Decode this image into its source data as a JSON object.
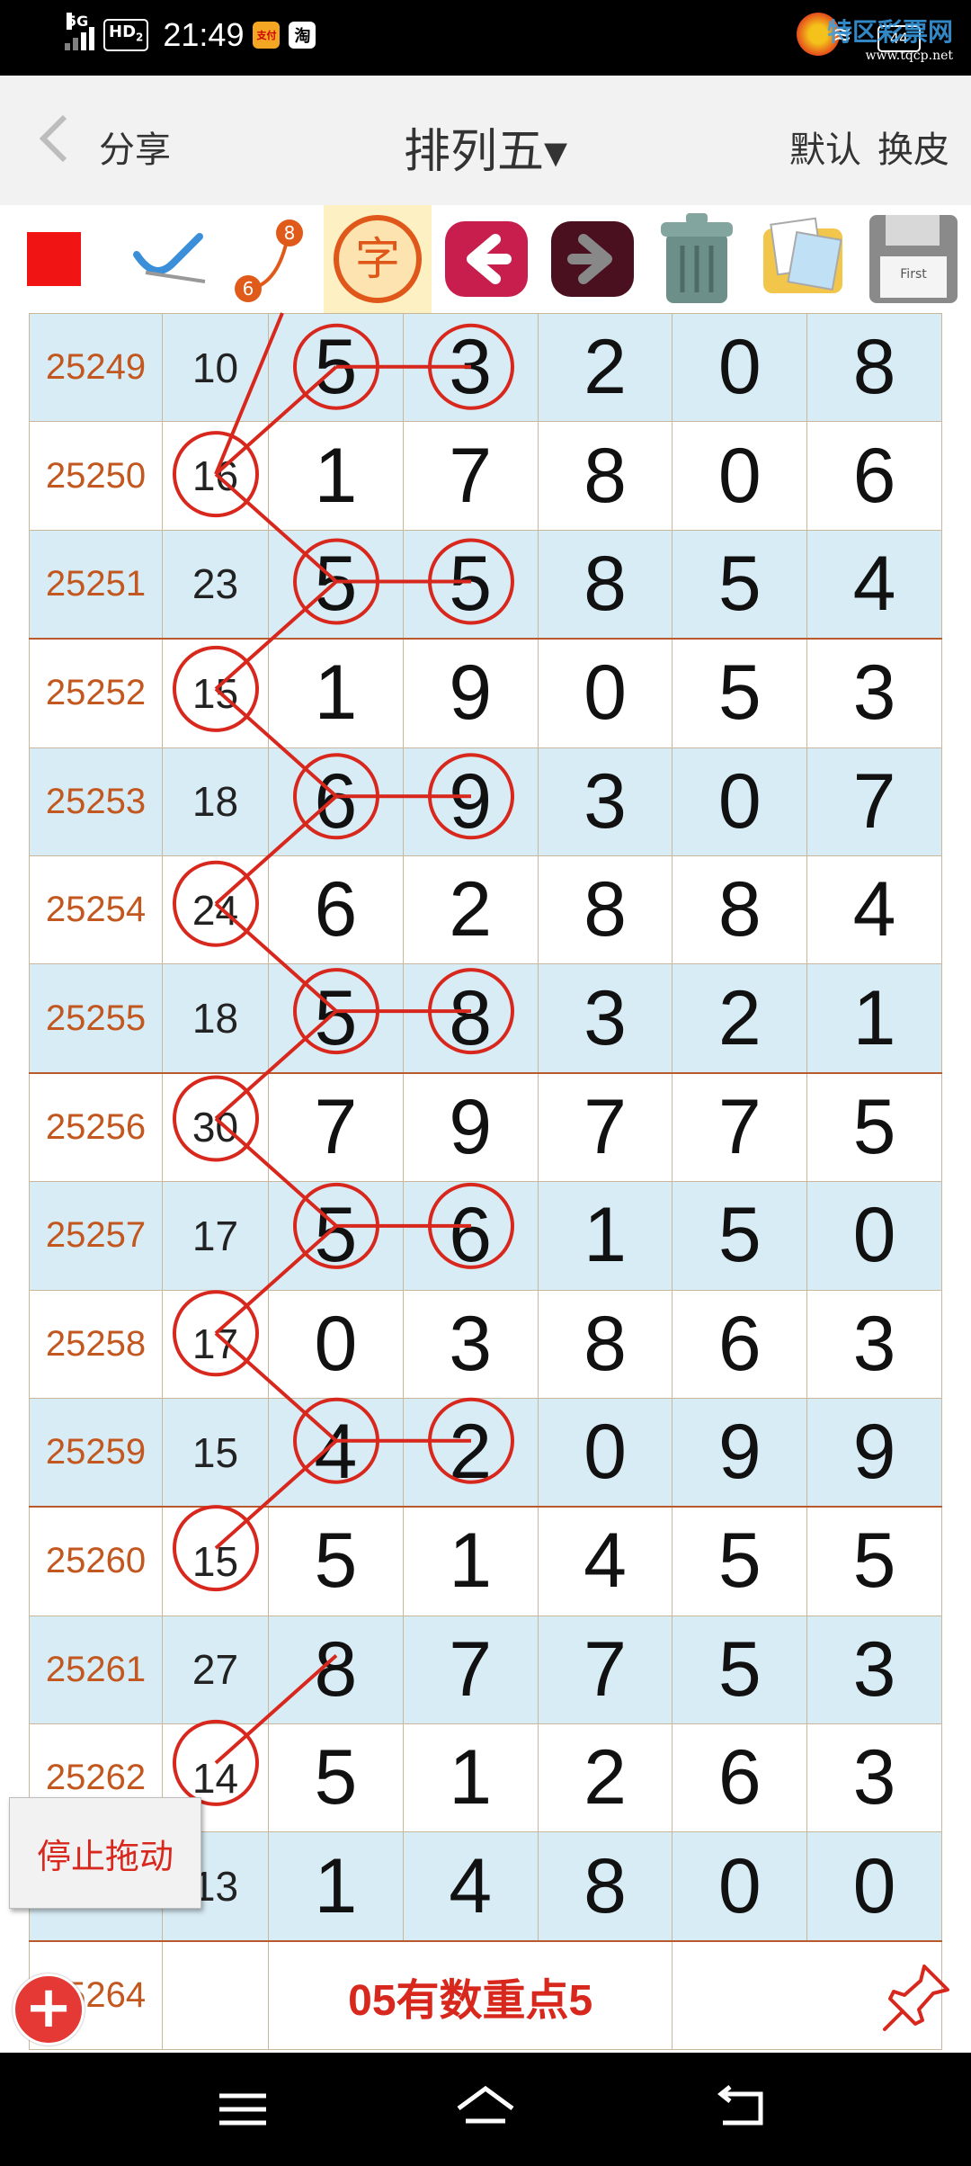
{
  "status_bar": {
    "network_label": "5G",
    "hd_label": "HD",
    "hd_sub": "2",
    "time": "21:49",
    "app_icons": [
      "支付",
      "淘"
    ],
    "battery": "44",
    "watermark": "特区彩票网",
    "watermark_url": "www.tqcp.net"
  },
  "header": {
    "share_label": "分享",
    "title": "排列五▾",
    "default_label": "默认",
    "skin_label": "换皮"
  },
  "toolbar": {
    "icons": [
      "red-square-icon",
      "pen-icon",
      "numbered-line-icon",
      "character-icon",
      "back-arrow-icon",
      "forward-arrow-icon",
      "trash-icon",
      "images-icon",
      "save-disk-icon"
    ],
    "numbered_line": {
      "top": "8",
      "bottom": "6"
    },
    "character_label": "字",
    "disk_label": "First"
  },
  "rows": [
    {
      "issue": "25249",
      "sum": "10",
      "d": [
        "5",
        "3",
        "2",
        "0",
        "8"
      ]
    },
    {
      "issue": "25250",
      "sum": "16",
      "d": [
        "1",
        "7",
        "8",
        "0",
        "6"
      ]
    },
    {
      "issue": "25251",
      "sum": "23",
      "d": [
        "5",
        "5",
        "8",
        "5",
        "4"
      ]
    },
    {
      "issue": "25252",
      "sum": "15",
      "d": [
        "1",
        "9",
        "0",
        "5",
        "3"
      ]
    },
    {
      "issue": "25253",
      "sum": "18",
      "d": [
        "6",
        "9",
        "3",
        "0",
        "7"
      ]
    },
    {
      "issue": "25254",
      "sum": "24",
      "d": [
        "6",
        "2",
        "8",
        "8",
        "4"
      ]
    },
    {
      "issue": "25255",
      "sum": "18",
      "d": [
        "5",
        "8",
        "3",
        "2",
        "1"
      ]
    },
    {
      "issue": "25256",
      "sum": "30",
      "d": [
        "7",
        "9",
        "7",
        "7",
        "5"
      ]
    },
    {
      "issue": "25257",
      "sum": "17",
      "d": [
        "5",
        "6",
        "1",
        "5",
        "0"
      ]
    },
    {
      "issue": "25258",
      "sum": "17",
      "d": [
        "0",
        "3",
        "8",
        "6",
        "3"
      ]
    },
    {
      "issue": "25259",
      "sum": "15",
      "d": [
        "4",
        "2",
        "0",
        "9",
        "9"
      ]
    },
    {
      "issue": "25260",
      "sum": "15",
      "d": [
        "5",
        "1",
        "4",
        "5",
        "5"
      ]
    },
    {
      "issue": "25261",
      "sum": "27",
      "d": [
        "8",
        "7",
        "7",
        "5",
        "3"
      ]
    },
    {
      "issue": "25262",
      "sum": "14",
      "d": [
        "5",
        "1",
        "2",
        "6",
        "3"
      ]
    },
    {
      "issue": "",
      "sum": "13",
      "d": [
        "1",
        "4",
        "8",
        "0",
        "0"
      ]
    }
  ],
  "note_row": {
    "issue": "25264",
    "text": "05有数重点5"
  },
  "float_button": "停止拖动",
  "colors": {
    "accent_red": "#d8281d",
    "row_blue": "#d8ecf5",
    "issue_orange": "#c2571f"
  },
  "nav_icons": [
    "menu-icon",
    "home-icon",
    "back-icon"
  ]
}
